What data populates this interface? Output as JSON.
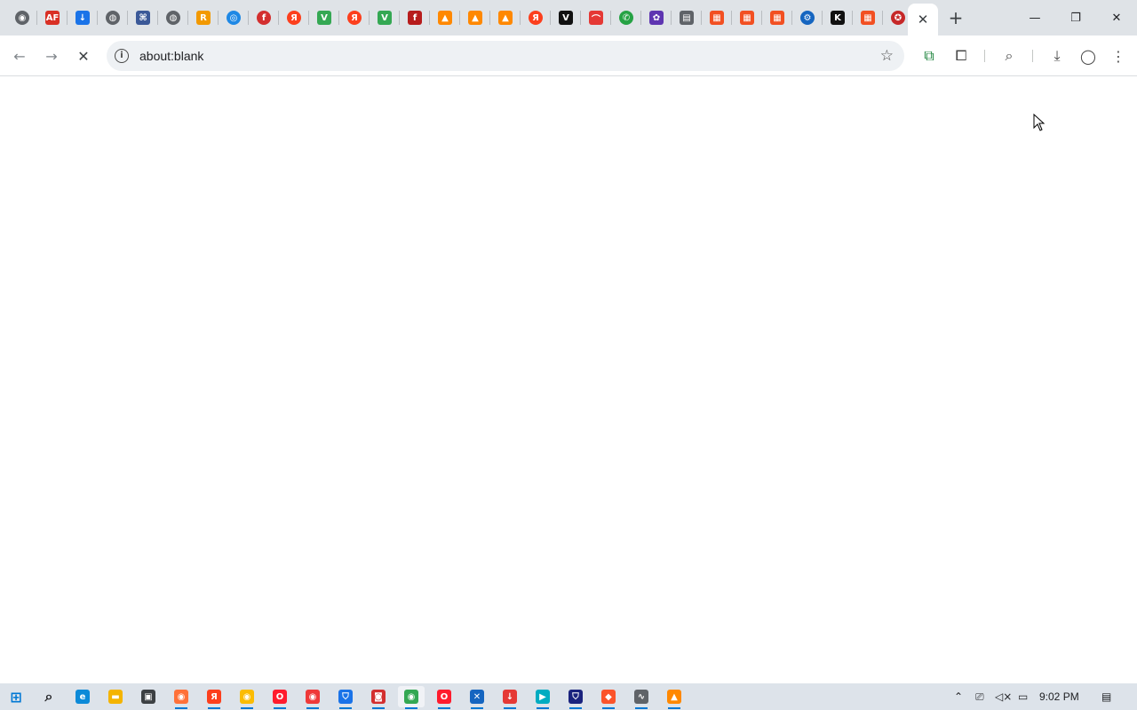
{
  "window": {
    "minimize_glyph": "—",
    "restore_glyph": "❐",
    "close_glyph": "✕"
  },
  "tabs": {
    "favicons": [
      {
        "icon": "chrome-icon",
        "color": "#5f6368",
        "glyph": "◉",
        "round": true
      },
      {
        "icon": "af-icon",
        "color": "#d93025",
        "glyph": "AF",
        "round": false
      },
      {
        "icon": "download-icon",
        "color": "#1a73e8",
        "glyph": "↓",
        "round": false
      },
      {
        "icon": "globe-icon",
        "color": "#5f6368",
        "glyph": "◍",
        "round": true
      },
      {
        "icon": "puzzle-site-icon",
        "color": "#3b5998",
        "glyph": "⌘",
        "round": false
      },
      {
        "icon": "globe-icon",
        "color": "#5f6368",
        "glyph": "◍",
        "round": true
      },
      {
        "icon": "rss-icon",
        "color": "#f29900",
        "glyph": "R",
        "round": false
      },
      {
        "icon": "target-icon",
        "color": "#1e88e5",
        "glyph": "◎",
        "round": true
      },
      {
        "icon": "flash-icon",
        "color": "#d32f2f",
        "glyph": "f",
        "round": true
      },
      {
        "icon": "yandex-icon",
        "color": "#fc3f1d",
        "glyph": "Я",
        "round": true
      },
      {
        "icon": "leaf-icon",
        "color": "#34a853",
        "glyph": "V",
        "round": false
      },
      {
        "icon": "yandex-icon",
        "color": "#fc3f1d",
        "glyph": "Я",
        "round": true
      },
      {
        "icon": "leaf-icon",
        "color": "#34a853",
        "glyph": "V",
        "round": false
      },
      {
        "icon": "flash-player-icon",
        "color": "#b71c1c",
        "glyph": "f",
        "round": false
      },
      {
        "icon": "vlc-icon",
        "color": "#ff8800",
        "glyph": "▲",
        "round": false
      },
      {
        "icon": "vlc-icon",
        "color": "#ff8800",
        "glyph": "▲",
        "round": false
      },
      {
        "icon": "vlc-icon",
        "color": "#ff8800",
        "glyph": "▲",
        "round": false
      },
      {
        "icon": "yandex-icon",
        "color": "#fc3f1d",
        "glyph": "Я",
        "round": true
      },
      {
        "icon": "v-logo-icon",
        "color": "#111111",
        "glyph": "V",
        "round": false
      },
      {
        "icon": "rainbow-icon",
        "color": "#e53935",
        "glyph": "⌒",
        "round": false
      },
      {
        "icon": "whatsapp-icon",
        "color": "#25a244",
        "glyph": "✆",
        "round": true
      },
      {
        "icon": "flower-icon",
        "color": "#5e35b1",
        "glyph": "✿",
        "round": false
      },
      {
        "icon": "news-icon",
        "color": "#5f6368",
        "glyph": "▤",
        "round": false
      },
      {
        "icon": "microsoft-icon",
        "color": "#f25022",
        "glyph": "▦",
        "round": false
      },
      {
        "icon": "microsoft-icon",
        "color": "#f25022",
        "glyph": "▦",
        "round": false
      },
      {
        "icon": "microsoft-icon",
        "color": "#f25022",
        "glyph": "▦",
        "round": false
      },
      {
        "icon": "settings-gear-icon",
        "color": "#1565c0",
        "glyph": "⚙",
        "round": true
      },
      {
        "icon": "k-logo-icon",
        "color": "#111111",
        "glyph": "K",
        "round": false
      },
      {
        "icon": "microsoft-icon",
        "color": "#f25022",
        "glyph": "▦",
        "round": false
      },
      {
        "icon": "emblem-icon",
        "color": "#c62828",
        "glyph": "✪",
        "round": true
      }
    ],
    "active_close_glyph": "✕",
    "new_tab_glyph": "+"
  },
  "toolbar": {
    "back_glyph": "←",
    "forward_glyph": "→",
    "stop_glyph": "✕",
    "info_glyph": "i",
    "url": "about:blank",
    "star_glyph": "☆",
    "extension_glyph": "⧉",
    "puzzle_glyph": "⧠",
    "search_tab_glyph": "⌕",
    "download_glyph": "⤓",
    "profile_glyph": "◯",
    "menu_glyph": "⋮"
  },
  "taskbar": {
    "items": [
      {
        "icon": "windows-start-icon",
        "color": "#0078d4",
        "glyph": "⊞"
      },
      {
        "icon": "search-icon",
        "color": "#202124",
        "glyph": "⌕"
      },
      {
        "icon": "edge-icon",
        "color": "#0c8ad8",
        "glyph": "e"
      },
      {
        "icon": "file-explorer-icon",
        "color": "#f4b400",
        "glyph": "▬"
      },
      {
        "icon": "store-icon",
        "color": "#3c4043",
        "glyph": "▣"
      },
      {
        "icon": "firefox-icon",
        "color": "#ff7139",
        "glyph": "◉"
      },
      {
        "icon": "yandex-browser-icon",
        "color": "#fc3f1d",
        "glyph": "Я"
      },
      {
        "icon": "chrome-icon",
        "color": "#fbbc04",
        "glyph": "◉"
      },
      {
        "icon": "opera-icon",
        "color": "#ff1b2d",
        "glyph": "O"
      },
      {
        "icon": "vivaldi-icon",
        "color": "#ef3939",
        "glyph": "◉"
      },
      {
        "icon": "defender-icon",
        "color": "#1a73e8",
        "glyph": "⛉"
      },
      {
        "icon": "camera-icon",
        "color": "#d32f2f",
        "glyph": "◙"
      },
      {
        "icon": "chrome-icon",
        "color": "#34a853",
        "glyph": "◉"
      },
      {
        "icon": "opera-icon",
        "color": "#ff1b2d",
        "glyph": "O"
      },
      {
        "icon": "tool-icon",
        "color": "#1565c0",
        "glyph": "✕"
      },
      {
        "icon": "downloader-icon",
        "color": "#e53935",
        "glyph": "↓"
      },
      {
        "icon": "media-icon",
        "color": "#00acc1",
        "glyph": "▶"
      },
      {
        "icon": "shield-icon",
        "color": "#1a237e",
        "glyph": "⛉"
      },
      {
        "icon": "brave-icon",
        "color": "#fb542b",
        "glyph": "◆"
      },
      {
        "icon": "chart-icon",
        "color": "#5f6368",
        "glyph": "∿"
      },
      {
        "icon": "vlc-icon",
        "color": "#ff8800",
        "glyph": "▲"
      }
    ],
    "tray": {
      "chevron_glyph": "⌃",
      "meet_glyph": "⎚",
      "volume_glyph": "◁×",
      "network_glyph": "▭",
      "time": "9:02 PM",
      "notification_glyph": "▤"
    }
  }
}
